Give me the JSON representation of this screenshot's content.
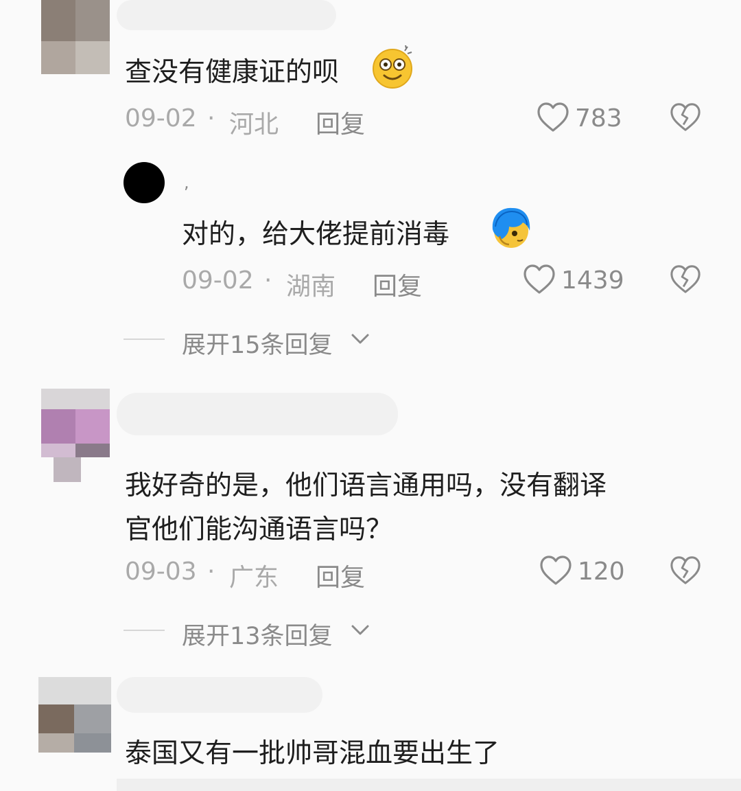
{
  "comments": [
    {
      "text": "查没有健康证的呗",
      "emoji": "dizzy-smile-emoji",
      "date": "09-02",
      "location": "河北",
      "reply_label": "回复",
      "likes": "783",
      "replies": [
        {
          "username": ",",
          "text": "对的，给大佬提前消毒",
          "emoji": "blue-hair-emoji",
          "date": "09-02",
          "location": "湖南",
          "reply_label": "回复",
          "likes": "1439"
        }
      ],
      "expand_label": "展开15条回复"
    },
    {
      "text_line1": "我好奇的是，他们语言通用吗，没有翻译",
      "text_line2": "官他们能沟通语言吗？",
      "date": "09-03",
      "location": "广东",
      "reply_label": "回复",
      "likes": "120",
      "expand_label": "展开13条回复"
    },
    {
      "text": "泰国又有一批帅哥混血要出生了"
    }
  ],
  "separator": "·",
  "colors": {
    "background": "#fafafa",
    "text": "#1e1e1e",
    "meta": "#a9a9a9",
    "action": "#8a8a8a"
  }
}
